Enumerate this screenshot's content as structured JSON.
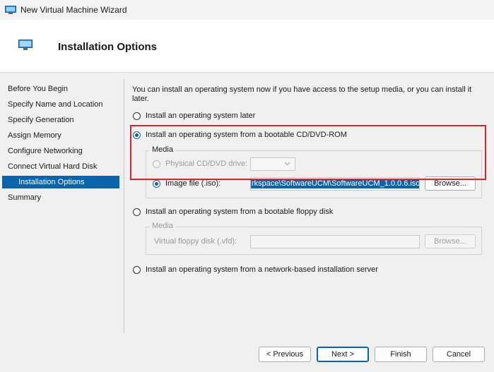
{
  "window": {
    "title": "New Virtual Machine Wizard"
  },
  "header": {
    "title": "Installation Options"
  },
  "sidebar": {
    "items": [
      {
        "label": "Before You Begin"
      },
      {
        "label": "Specify Name and Location"
      },
      {
        "label": "Specify Generation"
      },
      {
        "label": "Assign Memory"
      },
      {
        "label": "Configure Networking"
      },
      {
        "label": "Connect Virtual Hard Disk"
      },
      {
        "label": "Installation Options",
        "selected": true
      },
      {
        "label": "Summary"
      }
    ]
  },
  "main": {
    "intro": "You can install an operating system now if you have access to the setup media, or you can install it later.",
    "options": {
      "later": {
        "label": "Install an operating system later",
        "checked": false
      },
      "cd": {
        "label": "Install an operating system from a bootable CD/DVD-ROM",
        "checked": true
      },
      "floppy": {
        "label": "Install an operating system from a bootable floppy disk",
        "checked": false
      },
      "network": {
        "label": "Install an operating system from a network-based installation server",
        "checked": false
      }
    },
    "cd_media": {
      "legend": "Media",
      "physical_label": "Physical CD/DVD drive:",
      "image_label": "Image file (.iso):",
      "image_value": "rkspace\\SoftwareUCM\\SoftwareUCM_1.0.0.6.iso",
      "browse_label": "Browse..."
    },
    "floppy_media": {
      "legend": "Media",
      "file_label": "Virtual floppy disk (.vfd):",
      "file_value": "",
      "browse_label": "Browse..."
    }
  },
  "footer": {
    "previous": "< Previous",
    "next": "Next >",
    "finish": "Finish",
    "cancel": "Cancel"
  },
  "colors": {
    "accent": "#0a64ad",
    "highlight": "#d7262b"
  }
}
